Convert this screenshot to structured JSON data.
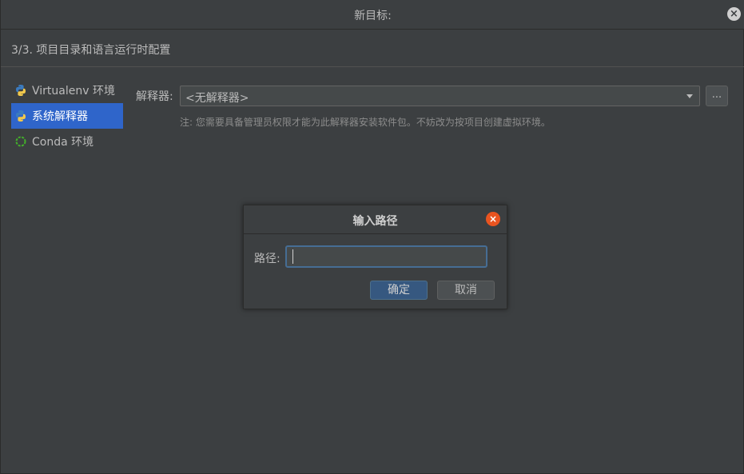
{
  "window": {
    "title": "新目标:",
    "close_glyph": "×"
  },
  "step": {
    "title": "3/3. 项目目录和语言运行时配置"
  },
  "sidebar": {
    "items": [
      {
        "label": "Virtualenv 环境",
        "icon": "python-icon"
      },
      {
        "label": "系统解释器",
        "icon": "python-icon",
        "selected": true
      },
      {
        "label": "Conda 环境",
        "icon": "conda-icon"
      }
    ]
  },
  "interpreter": {
    "label": "解释器:",
    "value": "<无解释器>",
    "browse_label": "...",
    "note": "注: 您需要具备管理员权限才能为此解释器安装软件包。不妨改为按项目创建虚拟环境。"
  },
  "dialog": {
    "title": "输入路径",
    "close_glyph": "×",
    "path_label": "路径:",
    "path_value": "",
    "ok_label": "确定",
    "cancel_label": "取消"
  },
  "colors": {
    "background": "#3c3f41",
    "selection": "#2f65ca",
    "dialog_close": "#e95420",
    "ok_button": "#365880",
    "input_focus": "#466d94"
  }
}
